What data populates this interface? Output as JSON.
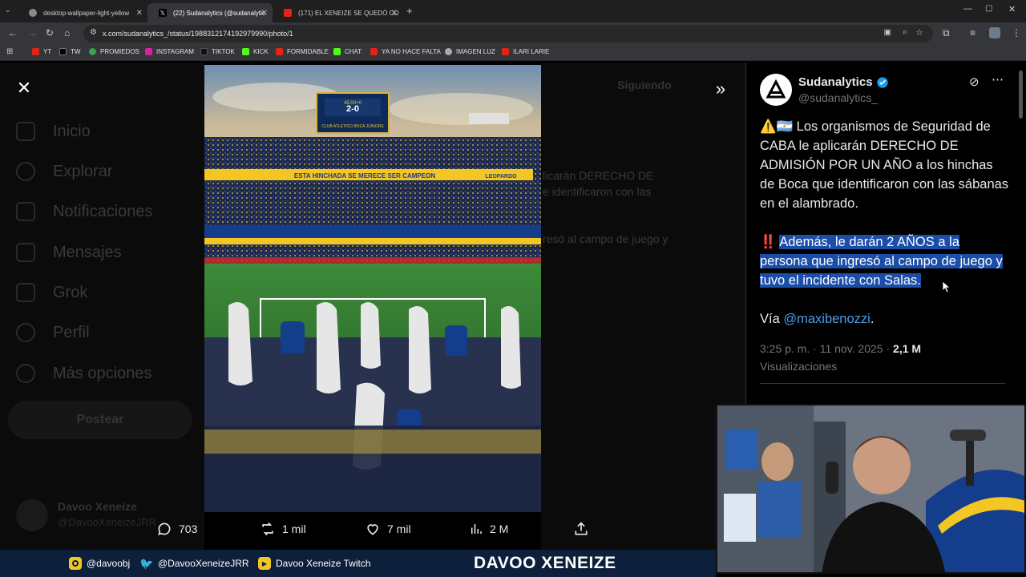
{
  "browser": {
    "tabs": [
      {
        "title": "desktop-wallpaper-light-yellow",
        "active": false
      },
      {
        "title": "(22) Sudanalytics (@sudanalytic",
        "active": true
      },
      {
        "title": "(171) EL XENEIZE SE QUEDÓ CO",
        "active": false
      }
    ],
    "url": "x.com/sudanalytics_/status/1988312174192979990/photo/1",
    "bookmarks": [
      "YT",
      "TW",
      "PROMIEDOS",
      "INSTAGRAM",
      "TIKTOK",
      "KICK",
      "FORMIDABLE",
      "CHAT",
      "YA NO HACE FALTA",
      "IMAGEN LUZ",
      "ILARI LARIE"
    ]
  },
  "background": {
    "sidebar": [
      "Inicio",
      "Explorar",
      "Notificaciones",
      "Mensajes",
      "Grok",
      "Perfil",
      "Más opciones"
    ],
    "post_button": "Postear",
    "following_label": "Siguiendo",
    "center_snippets": [
      "licarán DERECHO DE",
      "e identificaron con las",
      "resó al campo de juego y"
    ],
    "account_name": "Davoo Xeneize",
    "account_handle": "@DavooXeneizeJRR"
  },
  "photo": {
    "scoreboard": {
      "club": "CLUB ATLETICO BOCA JUNIORS",
      "score": "2-0",
      "time": "45:00+0"
    },
    "banner_text": "ESTA HINCHADA SE MERECE SER CAMPEON",
    "leopard_text": "LEOPARDO"
  },
  "actions": {
    "replies": "703",
    "reposts": "1 mil",
    "likes": "7 mil",
    "views": "2 M"
  },
  "tweet": {
    "name": "Sudanalytics",
    "handle": "@sudanalytics_",
    "para1_emoji": "⚠️🇦🇷",
    "para1": " Los organismos de Seguridad de CABA le aplicarán DERECHO DE ADMISIÓN POR UN AÑO a los hinchas de Boca que identificaron con las sábanas en el alambrado.",
    "para2_emoji": "‼️",
    "para2": "Además, le darán 2 AÑOS a la persona que ingresó al campo de juego y tuvo el incidente con Salas.",
    "via_prefix": "Vía ",
    "via_link": "@maxibenozzi",
    "via_suffix": ".",
    "timestamp": "3:25 p. m. · 11 nov. 2025 · ",
    "views_count": "2,1 M",
    "views_label": "Visualizaciones"
  },
  "stream": {
    "instagram": "@davoobj",
    "twitter": "@DavooXeneizeJRR",
    "twitch": "Davoo Xeneize Twitch",
    "brand": "DAVOO XENEIZE"
  },
  "colors": {
    "accent_blue": "#1d9bf0",
    "highlight": "#1a4ea8",
    "banner_navy": "#0c1f3b",
    "boca_blue": "#143d8c",
    "boca_yellow": "#f3c623"
  }
}
